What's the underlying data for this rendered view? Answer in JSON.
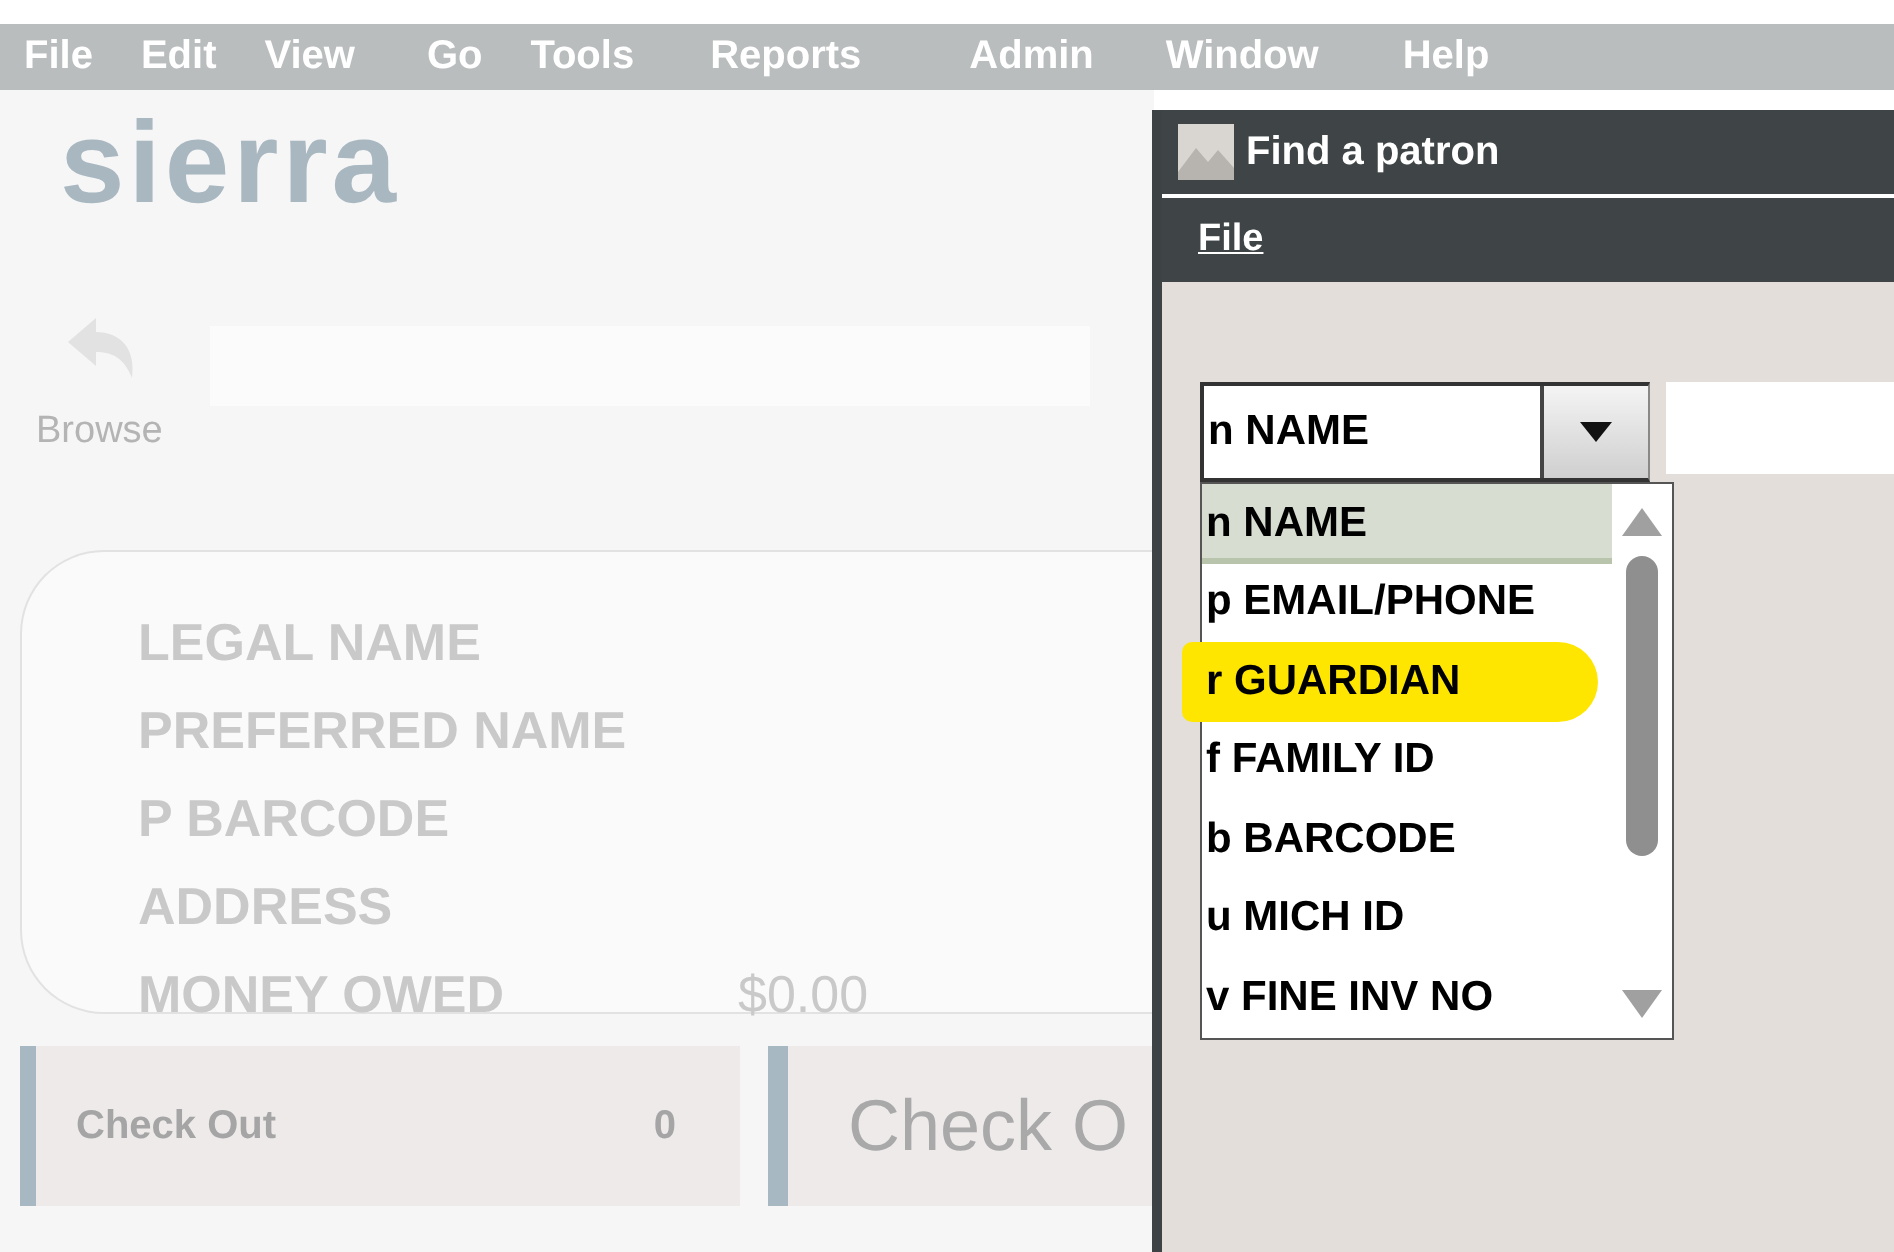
{
  "menu_bar": [
    "File",
    "Edit",
    "View",
    "Go",
    "Tools",
    "Reports",
    "Admin",
    "Window",
    "Help"
  ],
  "app": {
    "logo": "sierra",
    "browse_label": "Browse",
    "patron_fields": [
      {
        "label": "LEGAL NAME"
      },
      {
        "label": "PREFERRED NAME"
      },
      {
        "label": "P BARCODE"
      },
      {
        "label": "ADDRESS"
      },
      {
        "label": "MONEY OWED",
        "value": "$0.00"
      }
    ],
    "check_out_tab": {
      "label": "Check Out",
      "count": "0"
    },
    "check_out_heading": "Check O"
  },
  "dialog": {
    "title": "Find a patron",
    "menu": [
      "File"
    ],
    "search_type": {
      "value": "n NAME",
      "options": [
        {
          "label": "n NAME",
          "selected": true,
          "highlighted": false
        },
        {
          "label": "p EMAIL/PHONE",
          "selected": false,
          "highlighted": false
        },
        {
          "label": "r GUARDIAN",
          "selected": false,
          "highlighted": true
        },
        {
          "label": "f FAMILY ID",
          "selected": false,
          "highlighted": false
        },
        {
          "label": "b BARCODE",
          "selected": false,
          "highlighted": false
        },
        {
          "label": "u MICH ID",
          "selected": false,
          "highlighted": false
        },
        {
          "label": "v FINE INV NO",
          "selected": false,
          "highlighted": false
        }
      ]
    }
  }
}
